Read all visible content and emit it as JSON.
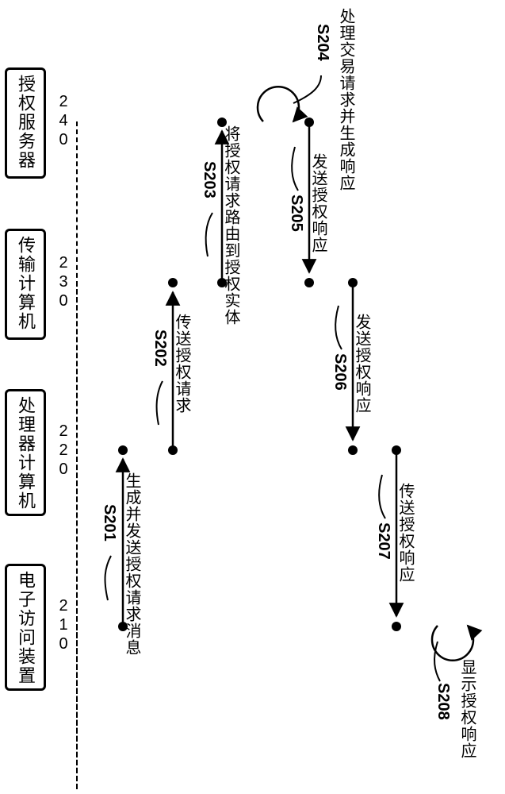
{
  "chart_data": {
    "type": "sequence-diagram",
    "participants": [
      {
        "id": "device",
        "name": "电子访问装置",
        "ref": "210"
      },
      {
        "id": "processor",
        "name": "处理器计算机",
        "ref": "220"
      },
      {
        "id": "transport",
        "name": "传输计算机",
        "ref": "230"
      },
      {
        "id": "authsrv",
        "name": "授权服务器",
        "ref": "240"
      }
    ],
    "steps": [
      {
        "code": "S201",
        "from": "device",
        "to": "processor",
        "text": "生成并发送授权请求消息"
      },
      {
        "code": "S202",
        "from": "processor",
        "to": "transport",
        "text": "传送授权请求"
      },
      {
        "code": "S203",
        "from": "transport",
        "to": "authsrv",
        "text": "将授权请求路由到授权实体"
      },
      {
        "code": "S204",
        "from": "authsrv",
        "to": "authsrv",
        "text": "处理交易请求并生成响应",
        "self": true
      },
      {
        "code": "S205",
        "from": "authsrv",
        "to": "transport",
        "text": "发送授权响应"
      },
      {
        "code": "S206",
        "from": "transport",
        "to": "processor",
        "text": "发送授权响应"
      },
      {
        "code": "S207",
        "from": "processor",
        "to": "device",
        "text": "传送授权响应"
      },
      {
        "code": "S208",
        "from": "device",
        "to": "device",
        "text": "显示授权响应",
        "self": true
      }
    ]
  },
  "lanes": {
    "device": {
      "name": "电子访问装置",
      "ref": "210"
    },
    "processor": {
      "name": "处理器计算机",
      "ref": "220"
    },
    "transport": {
      "name": "传输计算机",
      "ref": "230"
    },
    "authsrv": {
      "name": "授权服务器",
      "ref": "240"
    }
  },
  "steps": {
    "s201": {
      "code": "S201",
      "text": "生成并发送授权请求消息"
    },
    "s202": {
      "code": "S202",
      "text": "传送授权请求"
    },
    "s203": {
      "code": "S203",
      "text": "将授权请求路由到授权实体"
    },
    "s204": {
      "code": "S204",
      "text": "处理交易请求并生成响应"
    },
    "s205": {
      "code": "S205",
      "text": "发送授权响应"
    },
    "s206": {
      "code": "S206",
      "text": "发送授权响应"
    },
    "s207": {
      "code": "S207",
      "text": "传送授权响应"
    },
    "s208": {
      "code": "S208",
      "text": "显示授权响应"
    }
  }
}
